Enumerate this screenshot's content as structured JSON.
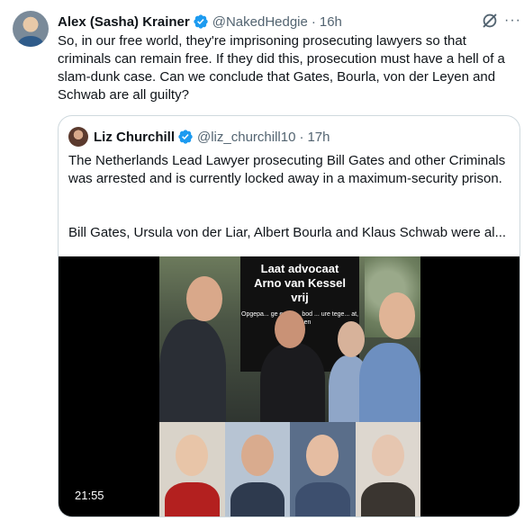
{
  "tweet": {
    "author_name": "Alex (Sasha) Krainer",
    "handle": "@NakedHedgie",
    "separator": "·",
    "time": "16h",
    "text": "So, in our free world, they're imprisoning prosecuting lawyers so that criminals can remain free. If they did this, prosecution must have a hell of a slam-dunk case. Can we conclude that Gates, Bourla, von der Leyen and Schwab are all guilty?",
    "more_label": "···",
    "icons": {
      "verified": "verified-badge-icon",
      "grok": "grok-icon",
      "more": "more-icon"
    },
    "colors": {
      "verified": "#1d9bf0",
      "secondary_text": "#536471",
      "border": "#cfd9de"
    }
  },
  "quote": {
    "author_name": "Liz Churchill",
    "handle": "@liz_churchill10",
    "separator": "·",
    "time": "17h",
    "text": "The Netherlands Lead Lawyer prosecuting Bill Gates and other Criminals was arrested and is currently locked away in a maximum-security prison.",
    "text2": "Bill Gates, Ursula von der Liar, Albert Bourla and Klaus Schwab were al...",
    "media": {
      "sign_line1": "Laat advocaat",
      "sign_line2": "Arno van Kessel",
      "sign_line3": "vrij",
      "sign_small": "Opgepa... ge een c... bod ... ure tege... at, ... es en",
      "duration": "21:55"
    }
  }
}
